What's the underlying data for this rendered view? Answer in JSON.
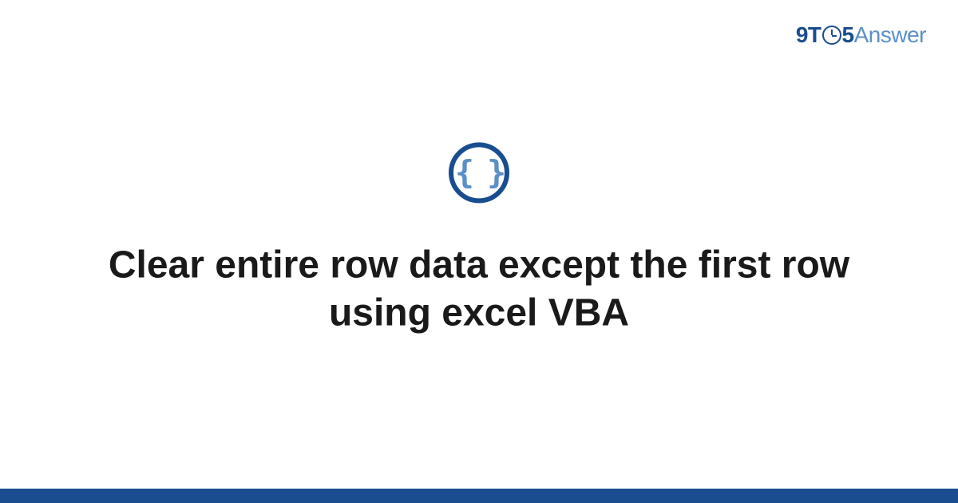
{
  "brand": {
    "part1": "9T",
    "part2": "5",
    "part3": "Answer"
  },
  "icon": {
    "glyph": "{ }",
    "name": "code-braces-icon"
  },
  "title": "Clear entire row data except the first row using excel VBA",
  "colors": {
    "primary": "#1a4d8f",
    "secondary": "#5b8fc7"
  }
}
